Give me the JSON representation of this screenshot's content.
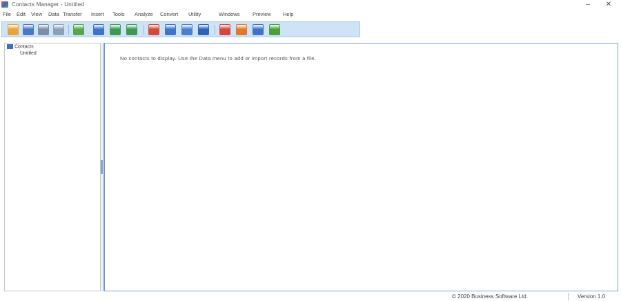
{
  "window": {
    "title": "Contacts Manager - Untitled",
    "minimize_glyph": "–",
    "close_glyph": "✕"
  },
  "menu": {
    "items": [
      {
        "label": "File"
      },
      {
        "label": "Edit"
      },
      {
        "label": "View"
      },
      {
        "label": "Data"
      },
      {
        "label": "Transfer"
      },
      {
        "label": "Insert"
      },
      {
        "label": "Tools"
      },
      {
        "label": "Analyze"
      },
      {
        "label": "Convert"
      },
      {
        "label": "Utility"
      },
      {
        "label": "Windows"
      },
      {
        "label": "Preview"
      },
      {
        "label": "Help"
      }
    ]
  },
  "toolbar": {
    "buttons": [
      {
        "icon": "open-folder-icon",
        "color": "#e8a33a"
      },
      {
        "icon": "save-icon",
        "color": "#4a79c4"
      },
      {
        "icon": "print-icon",
        "color": "#7d8fa8"
      },
      {
        "icon": "print-preview-icon",
        "color": "#8ea0b8"
      },
      {
        "icon": "tools-icon",
        "color": "#58a64a"
      },
      {
        "icon": "table-icon",
        "color": "#3f73c6"
      },
      {
        "icon": "import-icon",
        "color": "#3d9a55"
      },
      {
        "icon": "export-icon",
        "color": "#3d9a55"
      },
      {
        "icon": "calendar-icon",
        "color": "#d24a3a"
      },
      {
        "icon": "grid-icon",
        "color": "#3f73c6"
      },
      {
        "icon": "chart-icon",
        "color": "#4a7fd0"
      },
      {
        "icon": "database-icon",
        "color": "#2f63b8"
      },
      {
        "icon": "report-icon",
        "color": "#d2483a"
      },
      {
        "icon": "convert-icon",
        "color": "#e07a2a"
      },
      {
        "icon": "settings-icon",
        "color": "#3f73c6"
      },
      {
        "icon": "exit-icon",
        "color": "#4aa040"
      }
    ]
  },
  "tree": {
    "root_label": "Contacts",
    "child_label": "Untitled"
  },
  "main": {
    "message": "No contacts to display. Use the Data menu to add or import records from a file."
  },
  "status": {
    "company": "© 2020 Business Software Ltd.",
    "version": "Version 1.0"
  }
}
